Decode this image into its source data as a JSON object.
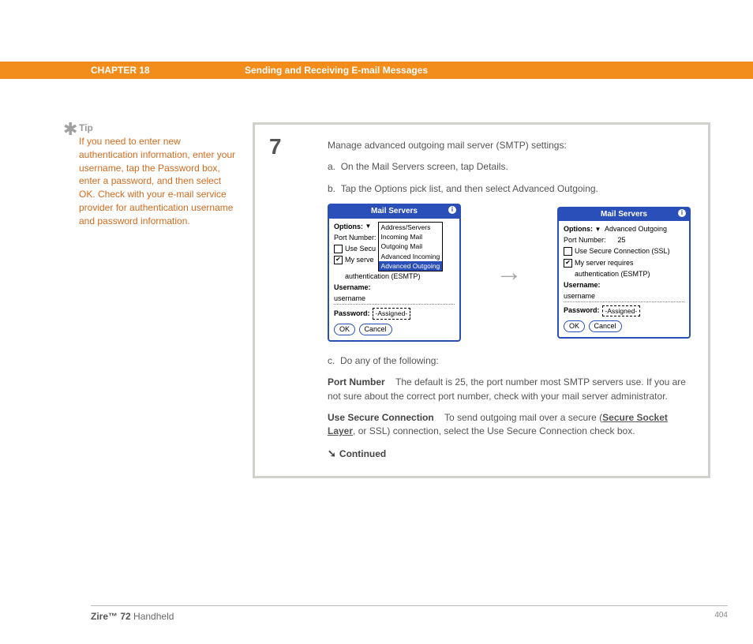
{
  "header": {
    "chapter": "CHAPTER 18",
    "title": "Sending and Receiving E-mail Messages"
  },
  "tip": {
    "heading": "Tip",
    "text": "If you need to enter new authentication information, enter your username, tap the Password box, enter a password, and then select OK. Check with your e-mail service provider for authentication username and password information."
  },
  "step": {
    "number": "7",
    "intro": "Manage advanced outgoing mail server (SMTP) settings:",
    "a": "On the Mail Servers screen, tap Details.",
    "b": "Tap the Options pick list, and then select Advanced Outgoing.",
    "c": "Do any of the following:",
    "portnum_label": "Port Number",
    "portnum_text": "The default is 25, the port number most SMTP servers use. If you are not sure about the correct port number, check with your mail server administrator.",
    "secure_label": "Use Secure Connection",
    "secure_text_pre": "To send outgoing mail over a secure (",
    "secure_link": "Secure Socket Layer",
    "secure_text_post": ", or SSL) connection, select the Use Secure Connection check box.",
    "continued": "Continued"
  },
  "screen1": {
    "title": "Mail Servers",
    "options_label": "Options:",
    "port_label": "Port Number:",
    "chk1_text": "Use Secu",
    "chk2_text": "My serve",
    "auth_line": "authentication (ESMTP)",
    "username_label": "Username:",
    "username_value": "username",
    "password_label": "Password:",
    "password_value": "-Assigned-",
    "ok": "OK",
    "cancel": "Cancel",
    "dropdown": {
      "opt1": "Address/Servers",
      "opt2": "Incoming Mail",
      "opt3": "Outgoing Mail",
      "opt4": "Advanced Incoming",
      "opt5": "Advanced Outgoing"
    }
  },
  "screen2": {
    "title": "Mail Servers",
    "options_label": "Options:",
    "options_value": "Advanced Outgoing",
    "port_label": "Port Number:",
    "port_value": "25",
    "chk1_text": "Use Secure Connection (SSL)",
    "chk2_text": "My server requires",
    "auth_line": "authentication (ESMTP)",
    "username_label": "Username:",
    "username_value": "username",
    "password_label": "Password:",
    "password_value": "-Assigned-",
    "ok": "OK",
    "cancel": "Cancel"
  },
  "footer": {
    "product_bold": "Zire™ 72",
    "product_rest": " Handheld",
    "page": "404"
  }
}
